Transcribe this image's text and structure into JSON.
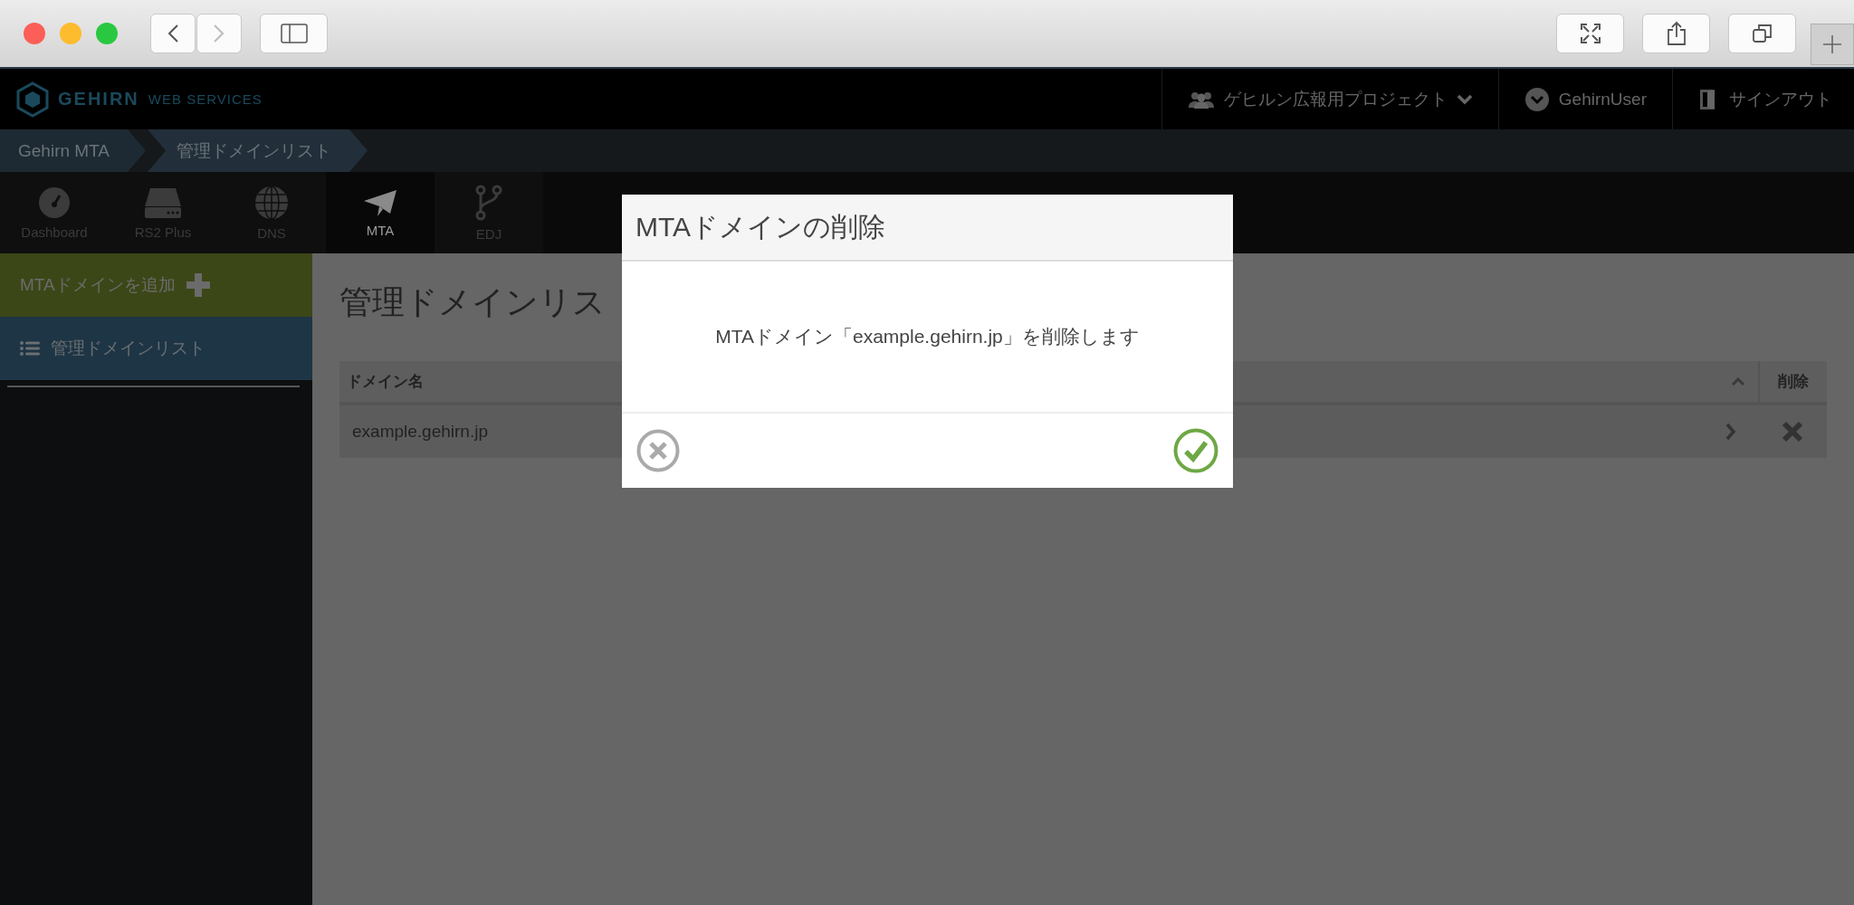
{
  "logo": {
    "name": "GEHIRN",
    "tagline": "WEB SERVICES"
  },
  "header": {
    "project": "ゲヒルン広報用プロジェクト",
    "user": "GehirnUser",
    "signout": "サインアウト"
  },
  "breadcrumbs": [
    "Gehirn MTA",
    "管理ドメインリスト"
  ],
  "nav_tabs": [
    {
      "label": "Dashboard",
      "kind": "gauge",
      "selected": false
    },
    {
      "label": "RS2 Plus",
      "kind": "drive",
      "selected": false
    },
    {
      "label": "DNS",
      "kind": "globe",
      "selected": false
    },
    {
      "label": "MTA",
      "kind": "plane",
      "selected": true
    },
    {
      "label": "EDJ",
      "kind": "branch",
      "selected": false
    }
  ],
  "sidebar": {
    "items": [
      {
        "label": "MTAドメインを追加",
        "kind": "add",
        "selected": false
      },
      {
        "label": "管理ドメインリスト",
        "kind": "list",
        "selected": true
      }
    ]
  },
  "page_title": "管理ドメインリス",
  "table": {
    "columns": [
      "ドメイン名",
      "削除"
    ],
    "rows": [
      {
        "domain": "example.gehirn.jp"
      }
    ]
  },
  "modal": {
    "title": "MTAドメインの削除",
    "message": "MTAドメイン「example.gehirn.jp」を削除します"
  }
}
